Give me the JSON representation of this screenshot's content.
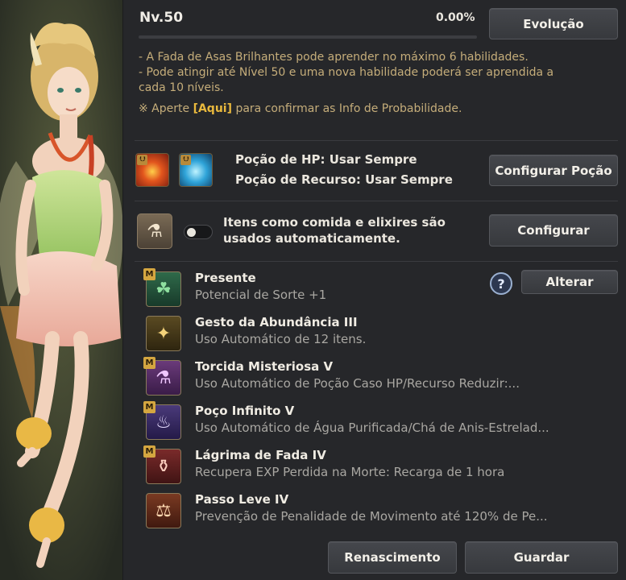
{
  "level": {
    "label": "Nv.50",
    "percent": "0.00%",
    "progress": 0.0
  },
  "buttons": {
    "evolution": "Evolução",
    "configure_potion": "Configurar Poção",
    "configure": "Configurar",
    "change": "Alterar",
    "rebirth": "Renascimento",
    "save": "Guardar"
  },
  "description": {
    "line1": "- A Fada de Asas Brilhantes pode aprender no máximo 6 habilidades.",
    "line2": "- Pode atingir até Nível 50 e uma nova habilidade poderá ser aprendida a",
    "line3": "cada 10 níveis.",
    "line4_prefix": "※ Aperte ",
    "line4_link": "[Aqui]",
    "line4_suffix": " para confirmar as Info de Probabilidade."
  },
  "potions": {
    "hp": "Poção de HP: Usar Sempre",
    "resource": "Poção de Recurso: Usar Sempre",
    "arrow_glyph": "⮋"
  },
  "auto_use": {
    "text": "Itens como comida e elixires são usados automaticamente.",
    "icon": "potion-gear-icon",
    "toggle_on": false
  },
  "help_glyph": "?",
  "skills": [
    {
      "badge": "M",
      "name": "Presente",
      "desc": "Potencial de Sorte +1",
      "icon": "clover-icon",
      "glyph": "☘"
    },
    {
      "badge": "",
      "name": "Gesto da Abundância III",
      "desc": "Uso Automático de 12 itens.",
      "icon": "fairy-icon",
      "glyph": "✦"
    },
    {
      "badge": "M",
      "name": "Torcida Misteriosa V",
      "desc": "Uso Automático de Poção Caso HP/Recurso Reduzir:...",
      "icon": "potions-icon",
      "glyph": "⚗"
    },
    {
      "badge": "M",
      "name": "Poço Infinito V",
      "desc": "Uso Automático de Água Purificada/Chá de Anis-Estrelad...",
      "icon": "bowl-icon",
      "glyph": "♨"
    },
    {
      "badge": "M",
      "name": "Lágrima de Fada IV",
      "desc": "Recupera EXP Perdida na Morte: Recarga de 1 hora",
      "icon": "tear-icon",
      "glyph": "⚱"
    },
    {
      "badge": "",
      "name": "Passo Leve IV",
      "desc": "Prevenção de Penalidade de Movimento até 120% de Pe...",
      "icon": "weight-icon",
      "glyph": "⚖"
    }
  ],
  "colors": {
    "accent_gold": "#e9b93d",
    "desc_text": "#c5ad7a",
    "panel_bg": "#26272a"
  }
}
